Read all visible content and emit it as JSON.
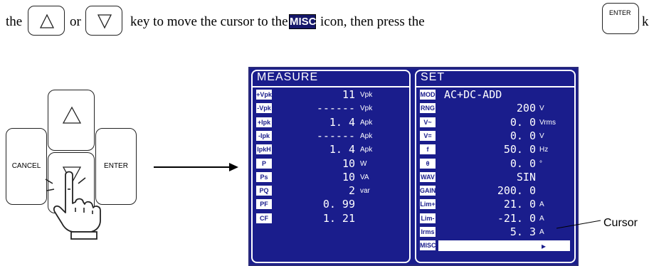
{
  "instruction": {
    "w_the": "the",
    "w_or": "or",
    "w_move": "key to move the cursor to the",
    "misc_icon": "MISC",
    "w_icon": "icon, then press the",
    "enter_key": "ENTER",
    "w_end": "k"
  },
  "keypad": {
    "cancel": "CANCEL",
    "enter": "ENTER"
  },
  "lcd": {
    "measure": {
      "title": "MEASURE",
      "rows": [
        {
          "icon": "+Vpk",
          "value": "11",
          "unit": "Vpk"
        },
        {
          "icon": "-Vpk",
          "value": "------",
          "unit": "Vpk"
        },
        {
          "icon": "+Ipk",
          "value": "1. 4",
          "unit": "Apk"
        },
        {
          "icon": "-Ipk",
          "value": "------",
          "unit": "Apk"
        },
        {
          "icon": "IpkH",
          "value": "1. 4",
          "unit": "Apk"
        },
        {
          "icon": "P",
          "value": "10",
          "unit": "W"
        },
        {
          "icon": "Ps",
          "value": "10",
          "unit": "VA"
        },
        {
          "icon": "PQ",
          "value": "2",
          "unit": "var"
        },
        {
          "icon": "PF",
          "value": "0. 99",
          "unit": ""
        },
        {
          "icon": "CF",
          "value": "1. 21",
          "unit": ""
        }
      ]
    },
    "set": {
      "title": "SET",
      "rows": [
        {
          "icon": "MOD",
          "value": "AC+DC-ADD",
          "unit": ""
        },
        {
          "icon": "RNG",
          "value": "200",
          "unit": "V"
        },
        {
          "icon": "V~",
          "value": "0. 0",
          "unit": "Vrms"
        },
        {
          "icon": "V=",
          "value": "0. 0",
          "unit": "V"
        },
        {
          "icon": "f",
          "value": "50. 0",
          "unit": "Hz"
        },
        {
          "icon": "θ",
          "value": "0. 0",
          "unit": "°"
        },
        {
          "icon": "WAV",
          "value": "SIN",
          "unit": ""
        },
        {
          "icon": "GAIN",
          "value": "200. 0",
          "unit": ""
        },
        {
          "icon": "Lim+",
          "value": "21. 0",
          "unit": "A"
        },
        {
          "icon": "Lim-",
          "value": "-21. 0",
          "unit": "A"
        },
        {
          "icon": "Irms",
          "value": "5. 3",
          "unit": "A"
        },
        {
          "icon": "MISC",
          "value": "",
          "unit": "▸"
        }
      ]
    }
  },
  "cursor_label": "Cursor",
  "colors": {
    "lcd_bg": "#1a1d8c",
    "lcd_fg": "#ffffff"
  }
}
